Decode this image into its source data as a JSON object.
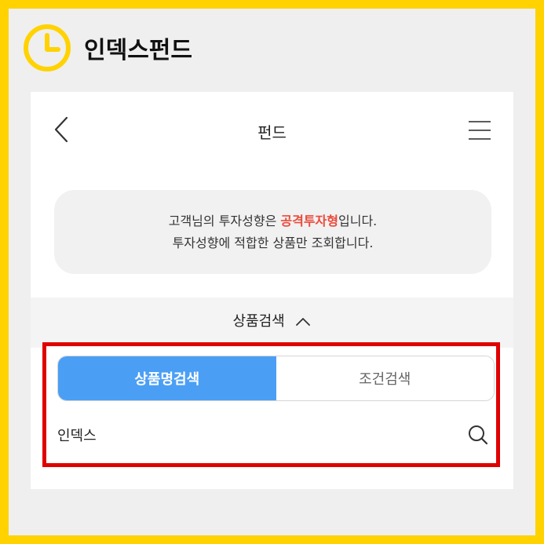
{
  "brand": {
    "title": "인덱스펀드"
  },
  "header": {
    "title": "펀드"
  },
  "notice": {
    "line1_prefix": "고객님의 투자성향은 ",
    "line1_accent": "공격투자형",
    "line1_suffix": "입니다.",
    "line2": "투자성향에 적합한 상품만 조회합니다."
  },
  "search": {
    "toggle_label": "상품검색",
    "tabs": [
      {
        "label": "상품명검색",
        "active": true
      },
      {
        "label": "조건검색",
        "active": false
      }
    ],
    "input_value": "인덱스"
  },
  "colors": {
    "frame": "#FFD200",
    "accent": "#e94b3c",
    "active_tab": "#4a9ff5",
    "highlight_border": "#e00000"
  },
  "icons": [
    "clock-icon",
    "back-arrow-icon",
    "hamburger-menu-icon",
    "chevron-up-icon",
    "search-icon"
  ]
}
